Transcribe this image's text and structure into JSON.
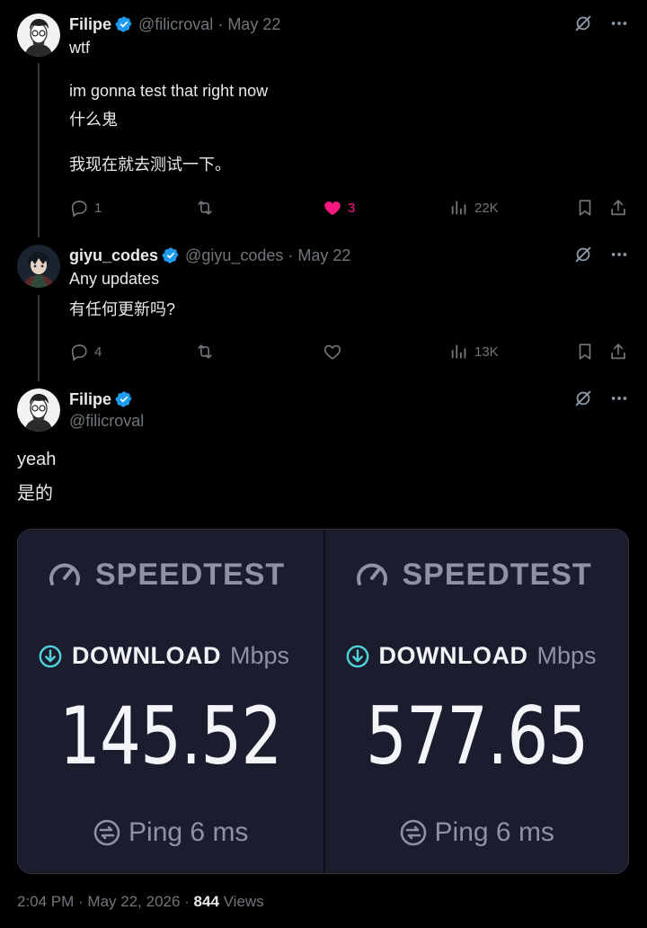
{
  "colors": {
    "background": "#000000",
    "text": "#e7e9ea",
    "muted": "#71767b",
    "verified": "#1d9bf0",
    "like": "#f91880",
    "speedtest_panel": "#1b1c2e",
    "speedtest_accent": "#4fd1d9"
  },
  "tweets": [
    {
      "name": "Filipe",
      "handle": "@filicroval",
      "date": "May 22",
      "lines": [
        "wtf",
        "",
        "im gonna test that right now",
        "什么鬼",
        "",
        "我现在就去测试一下。"
      ],
      "replies": "1",
      "reposts": "",
      "likes": "3",
      "views": "22K"
    },
    {
      "name": "giyu_codes",
      "handle": "@giyu_codes",
      "date": "May 22",
      "lines": [
        "Any updates",
        "有任何更新吗?"
      ],
      "replies": "4",
      "reposts": "",
      "likes": "",
      "views": "13K"
    }
  ],
  "main_tweet": {
    "name": "Filipe",
    "handle": "@filicroval",
    "lines": [
      "yeah",
      "是的"
    ],
    "speedtests": [
      {
        "brand": "SPEEDTEST",
        "label": "DOWNLOAD",
        "unit": "Mbps",
        "value": "145.52",
        "ping": "Ping 6 ms"
      },
      {
        "brand": "SPEEDTEST",
        "label": "DOWNLOAD",
        "unit": "Mbps",
        "value": "577.65",
        "ping": "Ping 6 ms"
      }
    ],
    "timestamp": "2:04 PM · May 22, 2026 · ",
    "views_count": "844",
    "views_label": " Views"
  },
  "icons": [
    "verified-icon",
    "grok-icon",
    "more-icon",
    "reply-icon",
    "repost-icon",
    "like-icon",
    "views-icon",
    "bookmark-icon",
    "share-icon",
    "speedometer-icon",
    "download-arrow-icon",
    "ping-icon"
  ]
}
